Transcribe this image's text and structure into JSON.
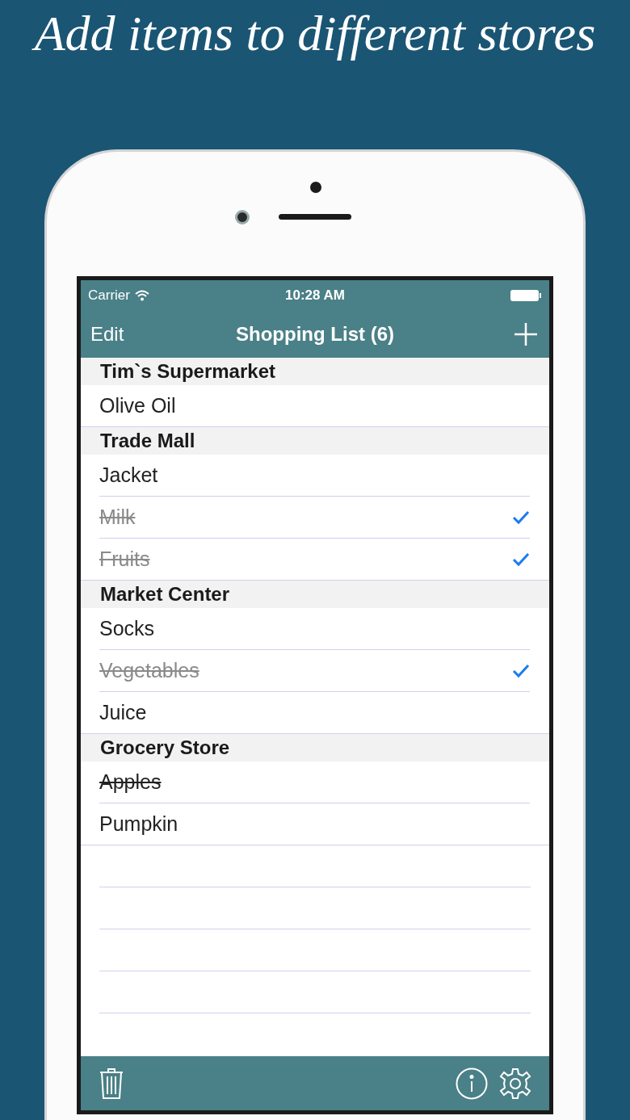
{
  "headline": "Add items to different stores",
  "status_bar": {
    "carrier": "Carrier",
    "time": "10:28 AM"
  },
  "nav_bar": {
    "left": "Edit",
    "title": "Shopping List (6)"
  },
  "sections": [
    {
      "name": "Tim`s Supermarket",
      "items": [
        {
          "name": "Olive Oil",
          "crossed_out": false,
          "checked": false
        }
      ]
    },
    {
      "name": "Trade Mall",
      "items": [
        {
          "name": "Jacket",
          "crossed_out": false,
          "checked": false
        },
        {
          "name": "Milk",
          "crossed_out": true,
          "checked": true
        },
        {
          "name": "Fruits",
          "crossed_out": true,
          "checked": true
        }
      ]
    },
    {
      "name": "Market Center",
      "items": [
        {
          "name": "Socks",
          "crossed_out": false,
          "checked": false
        },
        {
          "name": "Vegetables",
          "crossed_out": true,
          "checked": true
        },
        {
          "name": "Juice",
          "crossed_out": false,
          "checked": false
        }
      ]
    },
    {
      "name": "Grocery Store",
      "items": [
        {
          "name": "Apples",
          "crossed_out": true,
          "checked": false
        },
        {
          "name": "Pumpkin",
          "crossed_out": false,
          "checked": false
        }
      ]
    }
  ]
}
